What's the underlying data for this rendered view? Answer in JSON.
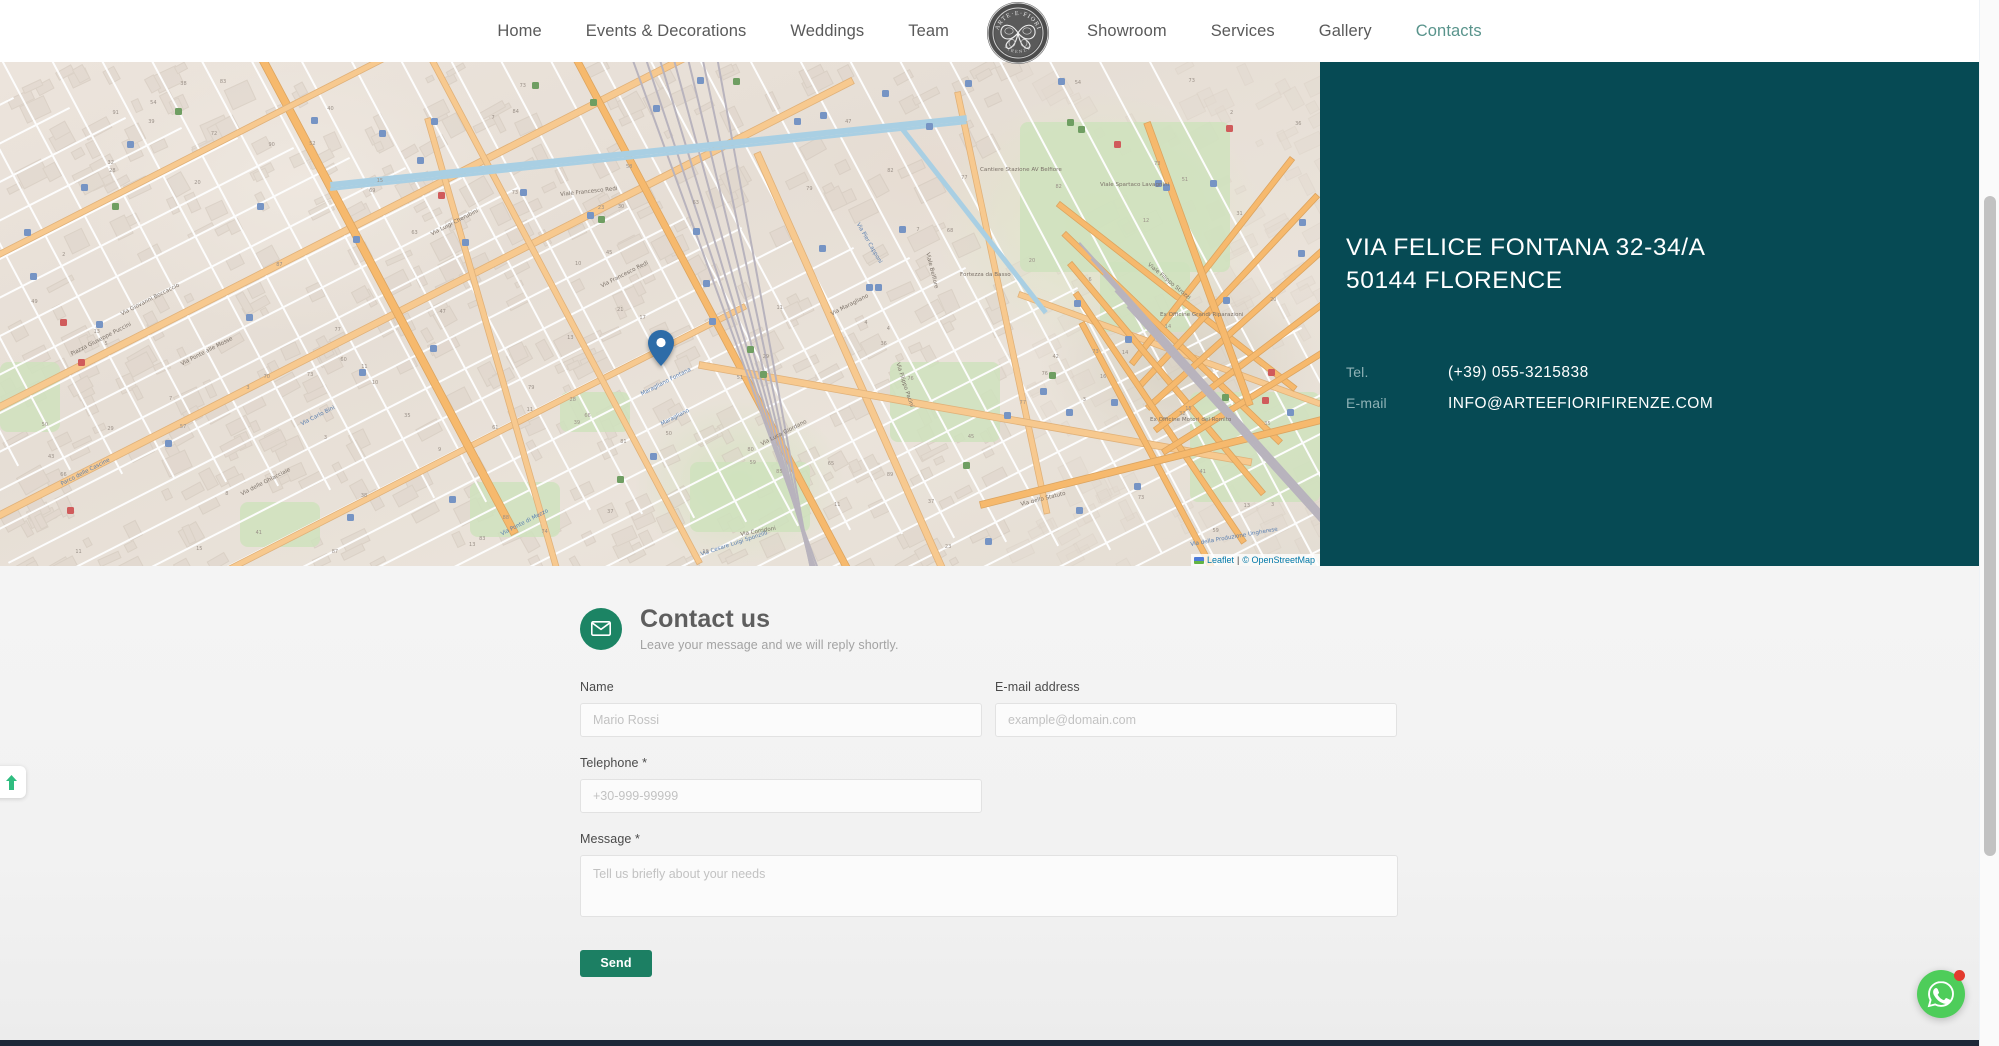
{
  "nav": {
    "links_left": [
      {
        "label": "Home",
        "active": false
      },
      {
        "label": "Events & Decorations",
        "active": false
      },
      {
        "label": "Weddings",
        "active": false
      },
      {
        "label": "Team",
        "active": false
      }
    ],
    "links_right": [
      {
        "label": "Showroom",
        "active": false
      },
      {
        "label": "Services",
        "active": false
      },
      {
        "label": "Gallery",
        "active": false
      },
      {
        "label": "Contacts",
        "active": true
      }
    ],
    "logo": {
      "icon": "arte-e-fiori-butterfly-logo",
      "top_text": "ARTE·E·FIORI",
      "bottom_text": "FIRENZE"
    }
  },
  "map": {
    "marker_icon": "map-pin-marker",
    "attribution_prefix": "Leaflet",
    "attribution_separator": "|",
    "attribution_osm": "© OpenStreetMap",
    "street_labels": [
      "Viale Francesco Redi",
      "Via Francesco Redi",
      "Via Maragliano",
      "Via Filippo Pacini",
      "Viale Belfiore",
      "Via Luigi Cherubini",
      "Via Ponte alle Mosse",
      "Via Giovanni Boccaccio",
      "Piazza Giuseppe Puccini",
      "Via delle Ghiacciaie",
      "Viale Filippo Strozzi",
      "Via Corridoni",
      "Via dello Statuto",
      "Viale Spartaco Lavagnini",
      "Via Luca Giordano",
      "Cantiere Stazione AV Belfiore",
      "Ex Officine Grandi Riparazioni",
      "Ex Officine Motori del Romito",
      "Fortezza da Basso",
      "Maragliano Fontana",
      "Maragliano",
      "Parco delle Cascine",
      "Via Ponte di Mezzo",
      "Via Cesare Luigi Sponzilli",
      "Via della Produzione Ungherese",
      "Via Carlo Bini",
      "Via Pier Capponi"
    ]
  },
  "info": {
    "address_line1": "VIA FELICE FONTANA 32-34/A",
    "address_line2": "50144 FLORENCE",
    "rows": [
      {
        "key": "Tel.",
        "value": "(+39) 055-3215838"
      },
      {
        "key": "E-mail",
        "value": "INFO@ARTEEFIORIFIRENZE.COM"
      }
    ],
    "panel_color": "#064a54"
  },
  "form": {
    "icon": "envelope-icon",
    "title": "Contact us",
    "subtitle": "Leave your message and we will reply shortly.",
    "fields": {
      "name": {
        "label": "Name",
        "placeholder": "Mario Rossi",
        "value": ""
      },
      "email": {
        "label": "E-mail address",
        "placeholder": "example@domain.com",
        "value": ""
      },
      "telephone": {
        "label": "Telephone *",
        "placeholder": "+30-999-99999",
        "value": ""
      },
      "message": {
        "label": "Message *",
        "placeholder": "Tell us briefly about your needs",
        "value": ""
      }
    },
    "submit_label": "Send",
    "accent_color": "#1c7f63"
  },
  "widgets": {
    "scroll_top": {
      "icon": "arrow-up-icon",
      "color": "#2fbd80"
    },
    "whatsapp": {
      "icon": "whatsapp-icon",
      "color": "#4ecd5a",
      "badge": ""
    }
  }
}
